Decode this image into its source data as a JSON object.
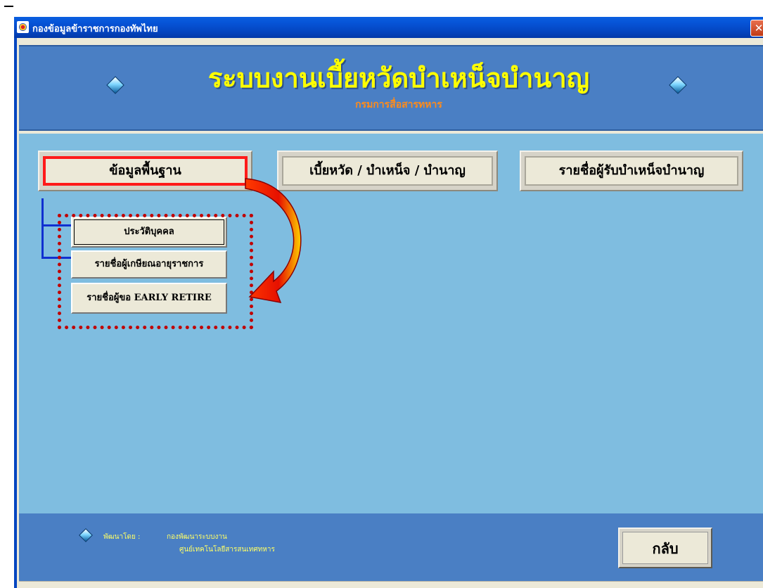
{
  "window": {
    "title": "กองข้อมูลข้าราชการกองทัพไทย",
    "close_glyph": "✕"
  },
  "header": {
    "title": "ระบบงานเบี้ยหวัดบำเหน็จบำนาญ",
    "subtitle": "กรมการสื่อสารทหาร"
  },
  "nav": {
    "tabs": [
      {
        "label": "ข้อมูลพื้นฐาน",
        "active": true
      },
      {
        "label": "เบี้ยหวัด / บำเหน็จ / บำนาญ",
        "active": false
      },
      {
        "label": "รายชื่อผู้รับบำเหน็จบำนาญ",
        "active": false
      }
    ]
  },
  "submenu": {
    "items": [
      {
        "label": "ประวัติบุคคล"
      },
      {
        "label": "รายชื่อผู้เกษียณอายุราชการ"
      },
      {
        "label": "รายชื่อผู้ขอ EARLY RETIRE"
      }
    ]
  },
  "footer": {
    "developer_label": "พัฒนาโดย  :",
    "developer_value_1": "กองพัฒนาระบบงาน",
    "developer_value_2": "ศูนย์เทคโนโลยีสารสนเทศทหาร",
    "back_label": "กลับ"
  },
  "colors": {
    "header_bg": "#4a7fc4",
    "header_title": "#ffff00",
    "header_subtitle": "#ff8c1a",
    "main_bg": "#7fbde0",
    "highlight_red": "#ff1a1a",
    "tree_line": "#1030d0"
  },
  "icons": {
    "window_icon": "thai-flag-crest-icon",
    "decorations": "diamond-icon",
    "annotation": "curved-red-arrow-icon"
  }
}
